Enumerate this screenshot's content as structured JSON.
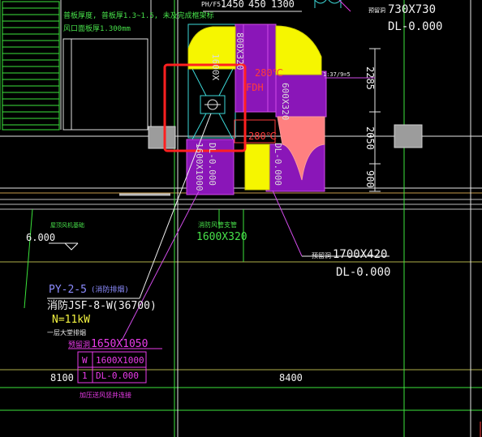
{
  "colors": {
    "background": "#000000",
    "duct_fill": "#8a16b8",
    "duct_line": "#d04be8",
    "elbow_yellow": "#f6f600",
    "salmon": "#ff8080",
    "cyan": "#3cd8d8",
    "green": "#3be33b",
    "olive": "#b0b04a",
    "grey": "#8c8c8c",
    "white": "#f2f2f2",
    "highlight_red": "#ff2020",
    "blue_text": "#8c8cff"
  },
  "top": {
    "dim_1450": "1450",
    "dim_450": "450",
    "dim_1300": "1300",
    "partial_label": "PH/F5..."
  },
  "notes": {
    "line1": "普板厚度, 普板厚1.3~1.5, 未及完成框架标",
    "line2": "风口面板厚1.300mm"
  },
  "openings": {
    "opening_top_right": {
      "prefix": "预留洞",
      "size": "730X730",
      "dl": "DL-0.000"
    },
    "opening_right": {
      "prefix": "预留洞",
      "size": "1700X420",
      "dl": "DL-0.000"
    },
    "opening_left": {
      "prefix": "预留洞",
      "size": "1650X1050"
    }
  },
  "duct_labels": {
    "vertical_top": "800X320",
    "vertical_mid": "600X320",
    "vertical_left_a": "1600X1000",
    "vertical_left_b": "DL-0.000",
    "vertical_right_b": "DL-0.000",
    "elbow_text_a": "1600X",
    "red_box_a": "280℃",
    "red_box_b": "FDH",
    "red_box_c": "280℃",
    "small_note": "1:37/9=5"
  },
  "right_dims": {
    "d2285": "2285",
    "d2050": "2050",
    "d900": "900"
  },
  "lower": {
    "level": "6.000",
    "green_small_note": "屋顶风机基础",
    "duct_support": "消防风管支管",
    "duct_support_size": "1600X320"
  },
  "equipment": {
    "tag": "PY-2-5",
    "tag_note": "(消防排烟)",
    "model": "消防JSF-8-W",
    "flow": "(36700)",
    "power": "N=11kW",
    "note": "一层大堂排烟"
  },
  "table": {
    "row1": {
      "code": "W",
      "value": "1600X1000"
    },
    "row2": {
      "code": "1",
      "value": "DL-0.000"
    }
  },
  "grid": {
    "left": "8100",
    "right": "8400",
    "bottom_note": "加压送风竖井连接"
  }
}
